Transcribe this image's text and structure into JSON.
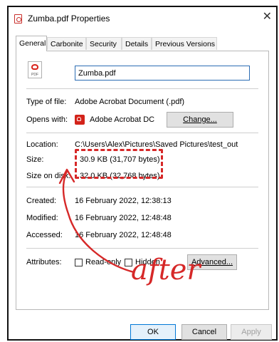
{
  "window": {
    "title": "Zumba.pdf Properties",
    "close_glyph": "✕"
  },
  "tabs": [
    {
      "label": "General",
      "active": true
    },
    {
      "label": "Carbonite",
      "active": false
    },
    {
      "label": "Security",
      "active": false
    },
    {
      "label": "Details",
      "active": false
    },
    {
      "label": "Previous Versions",
      "active": false
    }
  ],
  "file": {
    "icon": "pdf-file-icon",
    "icon_label": "PDF",
    "name": "Zumba.pdf"
  },
  "properties": {
    "type_label": "Type of file:",
    "type_value": "Adobe Acrobat Document (.pdf)",
    "opens_label": "Opens with:",
    "opens_value": "Adobe Acrobat DC",
    "opens_icon": "acrobat-icon",
    "change_button": "Change...",
    "location_label": "Location:",
    "location_value": "C:\\Users\\Alex\\Pictures\\Saved Pictures\\test_out",
    "size_label": "Size:",
    "size_value": "30.9 KB (31,707 bytes)",
    "disk_label": "Size on disk:",
    "disk_value": "32.0 KB (32,768 bytes)",
    "created_label": "Created:",
    "created_value": "16 February 2022, 12:38:13",
    "modified_label": "Modified:",
    "modified_value": "16 February 2022, 12:48:48",
    "accessed_label": "Accessed:",
    "accessed_value": "16 February 2022, 12:48:48",
    "attributes_label": "Attributes:",
    "readonly_label": "Read-only",
    "hidden_label": "Hidden",
    "advanced_button": "Advanced..."
  },
  "footer": {
    "ok": "OK",
    "cancel": "Cancel",
    "apply": "Apply"
  },
  "annotation": {
    "text": "after",
    "color": "#d62828"
  }
}
